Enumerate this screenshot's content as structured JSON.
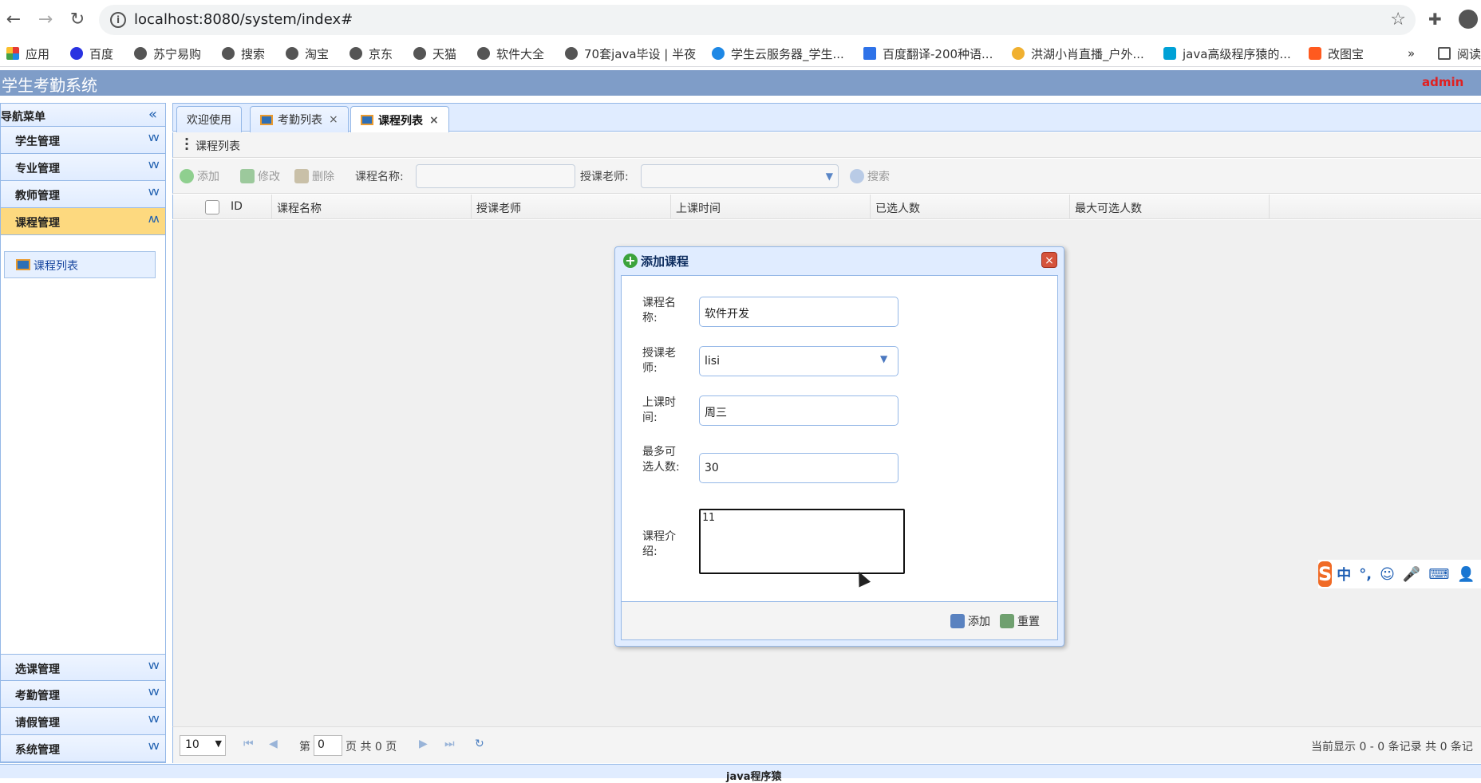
{
  "browser": {
    "url": "localhost:8080/system/index#",
    "bookmarks": [
      "应用",
      "百度",
      "苏宁易购",
      "搜索",
      "淘宝",
      "京东",
      "天猫",
      "软件大全",
      "70套java毕设 | 半夜",
      "学生云服务器_学生...",
      "百度翻译-200种语...",
      "洪湖小肖直播_户外...",
      "java高级程序猿的...",
      "改图宝"
    ],
    "more_label": "»",
    "reading_label": "阅读"
  },
  "app": {
    "title": "学生考勤系统",
    "user": "admin"
  },
  "sidebar": {
    "header": "导航菜单",
    "menus_top": [
      {
        "label": "学生管理"
      },
      {
        "label": "专业管理"
      },
      {
        "label": "教师管理"
      },
      {
        "label": "课程管理"
      }
    ],
    "course_item": "课程列表",
    "menus_bottom": [
      {
        "label": "选课管理"
      },
      {
        "label": "考勤管理"
      },
      {
        "label": "请假管理"
      },
      {
        "label": "系统管理"
      }
    ]
  },
  "tabs": [
    {
      "label": "欢迎使用"
    },
    {
      "label": "考勤列表",
      "close": "×"
    },
    {
      "label": "课程列表",
      "close": "×"
    }
  ],
  "panel": {
    "title": "课程列表"
  },
  "toolbar": {
    "add": "添加",
    "edit": "修改",
    "delete": "删除",
    "course_name_label": "课程名称:",
    "teacher_label": "授课老师:",
    "search": "搜索"
  },
  "grid": {
    "columns": [
      "ID",
      "课程名称",
      "授课老师",
      "上课时间",
      "已选人数",
      "最大可选人数"
    ]
  },
  "pager": {
    "page_size": "10",
    "page_prefix": "第",
    "page_value": "0",
    "page_suffix": "页 共 0 页",
    "info": "当前显示 0 - 0 条记录 共 0 条记"
  },
  "dialog": {
    "title": "添加课程",
    "close": "×",
    "fields": [
      {
        "label": "课程名称:",
        "value": "软件开发"
      },
      {
        "label": "授课老师:",
        "value": "lisi"
      },
      {
        "label": "上课时间:",
        "value": "周三"
      },
      {
        "label": "最多可选人数:",
        "value": "30"
      },
      {
        "label": "课程介绍:",
        "value": "11"
      }
    ],
    "add_button": "添加",
    "reset_button": "重置"
  },
  "ime": {
    "logo": "S",
    "items": [
      "中",
      "°,",
      "☺",
      "🎤",
      "⌨",
      "👤"
    ]
  },
  "footer": {
    "text": "java程序猿"
  },
  "colors": {
    "header": "#7f9dc8",
    "accent_border": "#95b8e7",
    "active_menu": "#fdd97f",
    "user": "#e02020"
  }
}
